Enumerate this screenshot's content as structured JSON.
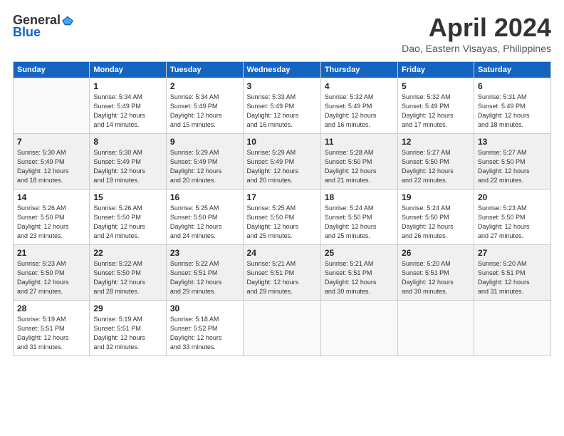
{
  "logo": {
    "general": "General",
    "blue": "Blue"
  },
  "title": "April 2024",
  "location": "Dao, Eastern Visayas, Philippines",
  "days_header": [
    "Sunday",
    "Monday",
    "Tuesday",
    "Wednesday",
    "Thursday",
    "Friday",
    "Saturday"
  ],
  "weeks": [
    [
      {
        "num": "",
        "info": ""
      },
      {
        "num": "1",
        "info": "Sunrise: 5:34 AM\nSunset: 5:49 PM\nDaylight: 12 hours\nand 14 minutes."
      },
      {
        "num": "2",
        "info": "Sunrise: 5:34 AM\nSunset: 5:49 PM\nDaylight: 12 hours\nand 15 minutes."
      },
      {
        "num": "3",
        "info": "Sunrise: 5:33 AM\nSunset: 5:49 PM\nDaylight: 12 hours\nand 16 minutes."
      },
      {
        "num": "4",
        "info": "Sunrise: 5:32 AM\nSunset: 5:49 PM\nDaylight: 12 hours\nand 16 minutes."
      },
      {
        "num": "5",
        "info": "Sunrise: 5:32 AM\nSunset: 5:49 PM\nDaylight: 12 hours\nand 17 minutes."
      },
      {
        "num": "6",
        "info": "Sunrise: 5:31 AM\nSunset: 5:49 PM\nDaylight: 12 hours\nand 18 minutes."
      }
    ],
    [
      {
        "num": "7",
        "info": "Sunrise: 5:30 AM\nSunset: 5:49 PM\nDaylight: 12 hours\nand 18 minutes."
      },
      {
        "num": "8",
        "info": "Sunrise: 5:30 AM\nSunset: 5:49 PM\nDaylight: 12 hours\nand 19 minutes."
      },
      {
        "num": "9",
        "info": "Sunrise: 5:29 AM\nSunset: 5:49 PM\nDaylight: 12 hours\nand 20 minutes."
      },
      {
        "num": "10",
        "info": "Sunrise: 5:29 AM\nSunset: 5:49 PM\nDaylight: 12 hours\nand 20 minutes."
      },
      {
        "num": "11",
        "info": "Sunrise: 5:28 AM\nSunset: 5:50 PM\nDaylight: 12 hours\nand 21 minutes."
      },
      {
        "num": "12",
        "info": "Sunrise: 5:27 AM\nSunset: 5:50 PM\nDaylight: 12 hours\nand 22 minutes."
      },
      {
        "num": "13",
        "info": "Sunrise: 5:27 AM\nSunset: 5:50 PM\nDaylight: 12 hours\nand 22 minutes."
      }
    ],
    [
      {
        "num": "14",
        "info": "Sunrise: 5:26 AM\nSunset: 5:50 PM\nDaylight: 12 hours\nand 23 minutes."
      },
      {
        "num": "15",
        "info": "Sunrise: 5:26 AM\nSunset: 5:50 PM\nDaylight: 12 hours\nand 24 minutes."
      },
      {
        "num": "16",
        "info": "Sunrise: 5:25 AM\nSunset: 5:50 PM\nDaylight: 12 hours\nand 24 minutes."
      },
      {
        "num": "17",
        "info": "Sunrise: 5:25 AM\nSunset: 5:50 PM\nDaylight: 12 hours\nand 25 minutes."
      },
      {
        "num": "18",
        "info": "Sunrise: 5:24 AM\nSunset: 5:50 PM\nDaylight: 12 hours\nand 25 minutes."
      },
      {
        "num": "19",
        "info": "Sunrise: 5:24 AM\nSunset: 5:50 PM\nDaylight: 12 hours\nand 26 minutes."
      },
      {
        "num": "20",
        "info": "Sunrise: 5:23 AM\nSunset: 5:50 PM\nDaylight: 12 hours\nand 27 minutes."
      }
    ],
    [
      {
        "num": "21",
        "info": "Sunrise: 5:23 AM\nSunset: 5:50 PM\nDaylight: 12 hours\nand 27 minutes."
      },
      {
        "num": "22",
        "info": "Sunrise: 5:22 AM\nSunset: 5:50 PM\nDaylight: 12 hours\nand 28 minutes."
      },
      {
        "num": "23",
        "info": "Sunrise: 5:22 AM\nSunset: 5:51 PM\nDaylight: 12 hours\nand 29 minutes."
      },
      {
        "num": "24",
        "info": "Sunrise: 5:21 AM\nSunset: 5:51 PM\nDaylight: 12 hours\nand 29 minutes."
      },
      {
        "num": "25",
        "info": "Sunrise: 5:21 AM\nSunset: 5:51 PM\nDaylight: 12 hours\nand 30 minutes."
      },
      {
        "num": "26",
        "info": "Sunrise: 5:20 AM\nSunset: 5:51 PM\nDaylight: 12 hours\nand 30 minutes."
      },
      {
        "num": "27",
        "info": "Sunrise: 5:20 AM\nSunset: 5:51 PM\nDaylight: 12 hours\nand 31 minutes."
      }
    ],
    [
      {
        "num": "28",
        "info": "Sunrise: 5:19 AM\nSunset: 5:51 PM\nDaylight: 12 hours\nand 31 minutes."
      },
      {
        "num": "29",
        "info": "Sunrise: 5:19 AM\nSunset: 5:51 PM\nDaylight: 12 hours\nand 32 minutes."
      },
      {
        "num": "30",
        "info": "Sunrise: 5:18 AM\nSunset: 5:52 PM\nDaylight: 12 hours\nand 33 minutes."
      },
      {
        "num": "",
        "info": ""
      },
      {
        "num": "",
        "info": ""
      },
      {
        "num": "",
        "info": ""
      },
      {
        "num": "",
        "info": ""
      }
    ]
  ]
}
